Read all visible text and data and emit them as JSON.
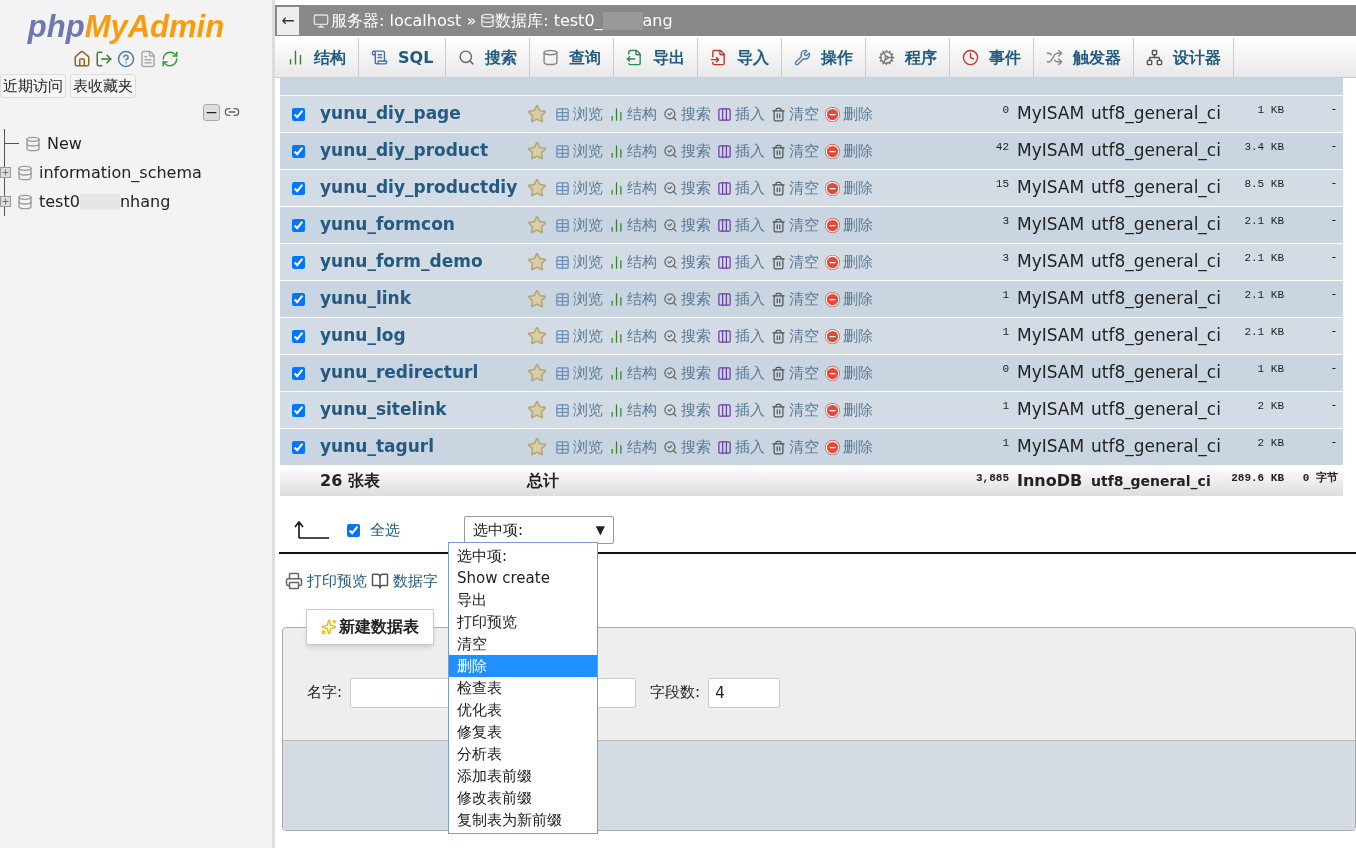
{
  "sidebar": {
    "logo": {
      "part1": "php",
      "part2": "MyAdmin"
    },
    "buttons": [
      "近期访问",
      "表收藏夹"
    ],
    "tree": [
      {
        "name": "New",
        "kind": "new"
      },
      {
        "name": "information_schema",
        "kind": "db"
      },
      {
        "name": "test0",
        "name_end": "nhang",
        "kind": "db_redacted"
      }
    ]
  },
  "breadcrumb": {
    "back": "←",
    "server": "服务器: localhost »",
    "database": "数据库: test0_",
    "database_end": "ang"
  },
  "tabs": [
    {
      "label": "结构",
      "kind": "structure",
      "selected": false
    },
    {
      "label": "SQL",
      "kind": "sql",
      "selected": false
    },
    {
      "label": "搜索",
      "kind": "search",
      "selected": false
    },
    {
      "label": "查询",
      "kind": "query",
      "selected": false
    },
    {
      "label": "导出",
      "kind": "export",
      "selected": false
    },
    {
      "label": "导入",
      "kind": "import",
      "selected": false
    },
    {
      "label": "操作",
      "kind": "operations",
      "selected": false
    },
    {
      "label": "程序",
      "kind": "routines",
      "selected": false
    },
    {
      "label": "事件",
      "kind": "events",
      "selected": false
    },
    {
      "label": "触发器",
      "kind": "triggers",
      "selected": false
    },
    {
      "label": "设计器",
      "kind": "designer",
      "selected": false
    }
  ],
  "table": {
    "rows": [
      {
        "checked": true,
        "name": "yunu_diy_page",
        "actions": [
          "浏览",
          "结构",
          "搜索",
          "插入",
          "清空",
          "删除"
        ],
        "rows": "0",
        "engine": "MyISAM",
        "collation": "utf8_general_ci",
        "size": "1 KB",
        "overhead": "-"
      },
      {
        "checked": true,
        "name": "yunu_diy_product",
        "actions": [
          "浏览",
          "结构",
          "搜索",
          "插入",
          "清空",
          "删除"
        ],
        "rows": "42",
        "engine": "MyISAM",
        "collation": "utf8_general_ci",
        "size": "3.4 KB",
        "overhead": "-"
      },
      {
        "checked": true,
        "name": "yunu_diy_productdiy",
        "actions": [
          "浏览",
          "结构",
          "搜索",
          "插入",
          "清空",
          "删除"
        ],
        "rows": "15",
        "engine": "MyISAM",
        "collation": "utf8_general_ci",
        "size": "8.5 KB",
        "overhead": "-"
      },
      {
        "checked": true,
        "name": "yunu_formcon",
        "actions": [
          "浏览",
          "结构",
          "搜索",
          "插入",
          "清空",
          "删除"
        ],
        "rows": "3",
        "engine": "MyISAM",
        "collation": "utf8_general_ci",
        "size": "2.1 KB",
        "overhead": "-"
      },
      {
        "checked": true,
        "name": "yunu_form_demo",
        "actions": [
          "浏览",
          "结构",
          "搜索",
          "插入",
          "清空",
          "删除"
        ],
        "rows": "3",
        "engine": "MyISAM",
        "collation": "utf8_general_ci",
        "size": "2.1 KB",
        "overhead": "-"
      },
      {
        "checked": true,
        "name": "yunu_link",
        "actions": [
          "浏览",
          "结构",
          "搜索",
          "插入",
          "清空",
          "删除"
        ],
        "rows": "1",
        "engine": "MyISAM",
        "collation": "utf8_general_ci",
        "size": "2.1 KB",
        "overhead": "-"
      },
      {
        "checked": true,
        "name": "yunu_log",
        "actions": [
          "浏览",
          "结构",
          "搜索",
          "插入",
          "清空",
          "删除"
        ],
        "rows": "1",
        "engine": "MyISAM",
        "collation": "utf8_general_ci",
        "size": "2.1 KB",
        "overhead": "-"
      },
      {
        "checked": true,
        "name": "yunu_redirecturl",
        "actions": [
          "浏览",
          "结构",
          "搜索",
          "插入",
          "清空",
          "删除"
        ],
        "rows": "0",
        "engine": "MyISAM",
        "collation": "utf8_general_ci",
        "size": "1 KB",
        "overhead": "-"
      },
      {
        "checked": true,
        "name": "yunu_sitelink",
        "actions": [
          "浏览",
          "结构",
          "搜索",
          "插入",
          "清空",
          "删除"
        ],
        "rows": "1",
        "engine": "MyISAM",
        "collation": "utf8_general_ci",
        "size": "2 KB",
        "overhead": "-"
      },
      {
        "checked": true,
        "name": "yunu_tagurl",
        "actions": [
          "浏览",
          "结构",
          "搜索",
          "插入",
          "清空",
          "删除"
        ],
        "rows": "1",
        "engine": "MyISAM",
        "collation": "utf8_general_ci",
        "size": "2 KB",
        "overhead": "-"
      }
    ],
    "footer": {
      "count": "26 张表",
      "label": "总计",
      "rows": "3,885",
      "engine": "InnoDB",
      "collation": "utf8_general_ci",
      "size": "289.6 KB",
      "overhead": "0 字节"
    }
  },
  "bulk": {
    "select_all": {
      "label": "全选",
      "checked": true
    },
    "select": {
      "value": "选中项:",
      "arrow": "▼"
    },
    "options": [
      {
        "label": "选中项:",
        "selected": false
      },
      {
        "label": "Show create",
        "selected": false
      },
      {
        "label": "导出",
        "selected": false
      },
      {
        "label": "打印预览",
        "selected": false
      },
      {
        "label": "清空",
        "selected": false
      },
      {
        "label": "删除",
        "selected": true
      },
      {
        "label": "检查表",
        "selected": false
      },
      {
        "label": "优化表",
        "selected": false
      },
      {
        "label": "修复表",
        "selected": false
      },
      {
        "label": "分析表",
        "selected": false
      },
      {
        "label": "添加表前缀",
        "selected": false
      },
      {
        "label": "修改表前缀",
        "selected": false
      },
      {
        "label": "复制表为新前缀",
        "selected": false
      }
    ]
  },
  "links": {
    "print": "打印预览",
    "dictionary": "数据字"
  },
  "create": {
    "button": "新建数据表",
    "name_label": "名字:",
    "columns_label": "字段数:",
    "columns_value": "4"
  }
}
